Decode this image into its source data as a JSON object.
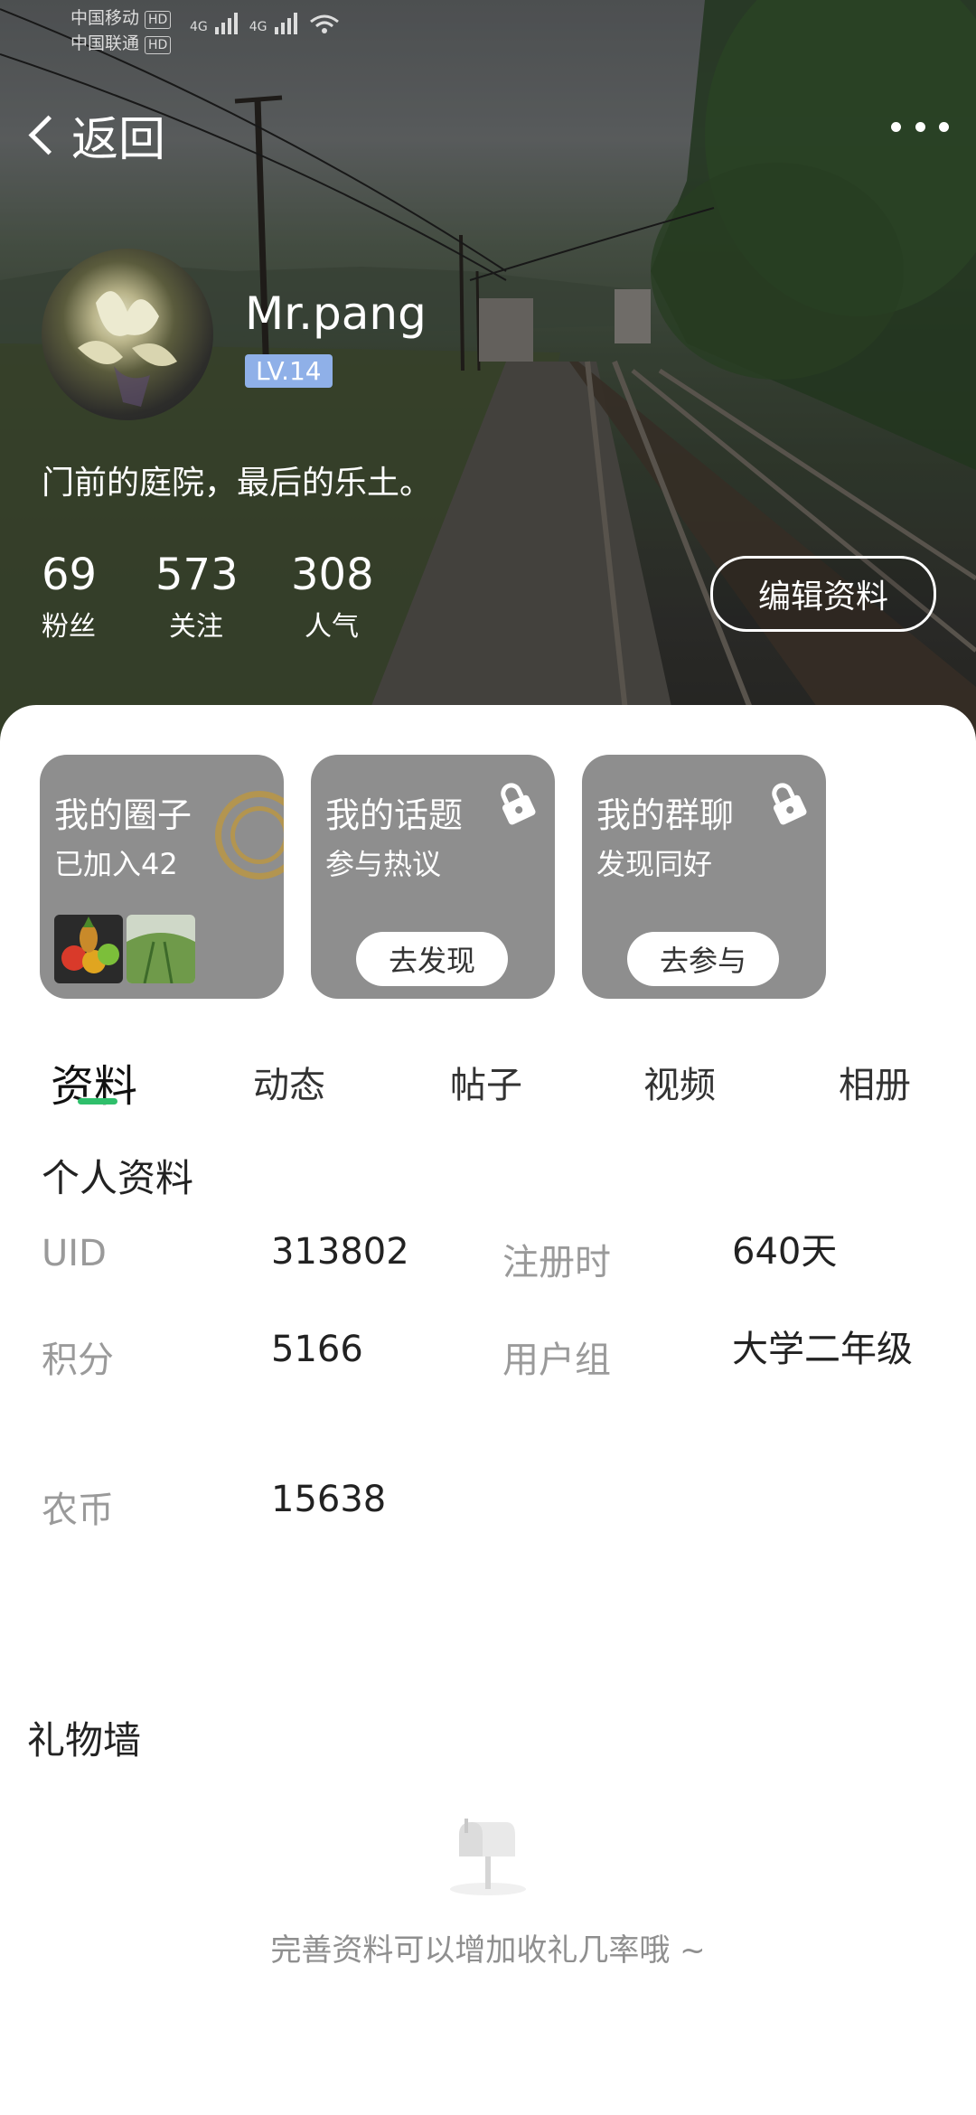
{
  "status_bar": {
    "carrier1": "中国移动",
    "carrier2": "中国联通",
    "hd": "HD",
    "net1": "4G",
    "net2": "4G"
  },
  "nav": {
    "back_label": "返回",
    "more_icon": "more-dots-icon"
  },
  "profile": {
    "username": "Mr.pang",
    "level": "LV.14",
    "bio": "门前的庭院，最后的乐土。",
    "stats": [
      {
        "value": "69",
        "label": "粉丝"
      },
      {
        "value": "573",
        "label": "关注"
      },
      {
        "value": "308",
        "label": "人气"
      }
    ],
    "edit_label": "编辑资料"
  },
  "cards": [
    {
      "title": "我的圈子",
      "subtitle": "已加入42",
      "button": ""
    },
    {
      "title": "我的话题",
      "subtitle": "参与热议",
      "button": "去发现"
    },
    {
      "title": "我的群聊",
      "subtitle": "发现同好",
      "button": "去参与"
    }
  ],
  "tabs": [
    "资料",
    "动态",
    "帖子",
    "视频",
    "相册"
  ],
  "info": {
    "title": "个人资料",
    "rows": [
      {
        "k1": "UID",
        "v1": "313802",
        "k2": "注册时",
        "v2": "640天"
      },
      {
        "k1": "积分",
        "v1": "5166",
        "k2": "用户组",
        "v2": "大学二年级"
      },
      {
        "k1": "农币",
        "v1": "15638",
        "k2": "",
        "v2": ""
      }
    ]
  },
  "gift": {
    "title": "礼物墙",
    "empty_text": "完善资料可以增加收礼几率哦 ~"
  },
  "colors": {
    "accent": "#2fbf6b",
    "card_bg": "#8e8e8e",
    "level_bg": "#8fb0e8"
  }
}
